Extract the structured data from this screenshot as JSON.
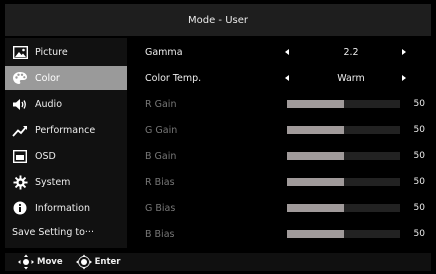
{
  "header": {
    "title": "Mode - User"
  },
  "sidebar": {
    "items": [
      {
        "label": "Picture",
        "icon": "picture-icon"
      },
      {
        "label": "Color",
        "icon": "palette-icon",
        "active": true
      },
      {
        "label": "Audio",
        "icon": "speaker-icon"
      },
      {
        "label": "Performance",
        "icon": "trend-up-icon"
      },
      {
        "label": "OSD",
        "icon": "osd-window-icon"
      },
      {
        "label": "System",
        "icon": "gear-icon"
      },
      {
        "label": "Information",
        "icon": "info-icon"
      }
    ],
    "save_label": "Save Setting to···"
  },
  "settings": {
    "gamma": {
      "label": "Gamma",
      "value": "2.2"
    },
    "color_temp": {
      "label": "Color Temp.",
      "value": "Warm"
    },
    "sliders": [
      {
        "label": "R Gain",
        "value": 50,
        "fraction": 0.5
      },
      {
        "label": "G Gain",
        "value": 50,
        "fraction": 0.5
      },
      {
        "label": "B Gain",
        "value": 50,
        "fraction": 0.5
      },
      {
        "label": "R Bias",
        "value": 50,
        "fraction": 0.5
      },
      {
        "label": "G Bias",
        "value": 50,
        "fraction": 0.5
      },
      {
        "label": "B Bias",
        "value": 50,
        "fraction": 0.5
      }
    ]
  },
  "footer": {
    "move_label": "Move",
    "enter_label": "Enter"
  },
  "colors": {
    "active_item": "#9a9a9a",
    "slider_fill": "#a09a9a",
    "slider_track": "#222222"
  }
}
